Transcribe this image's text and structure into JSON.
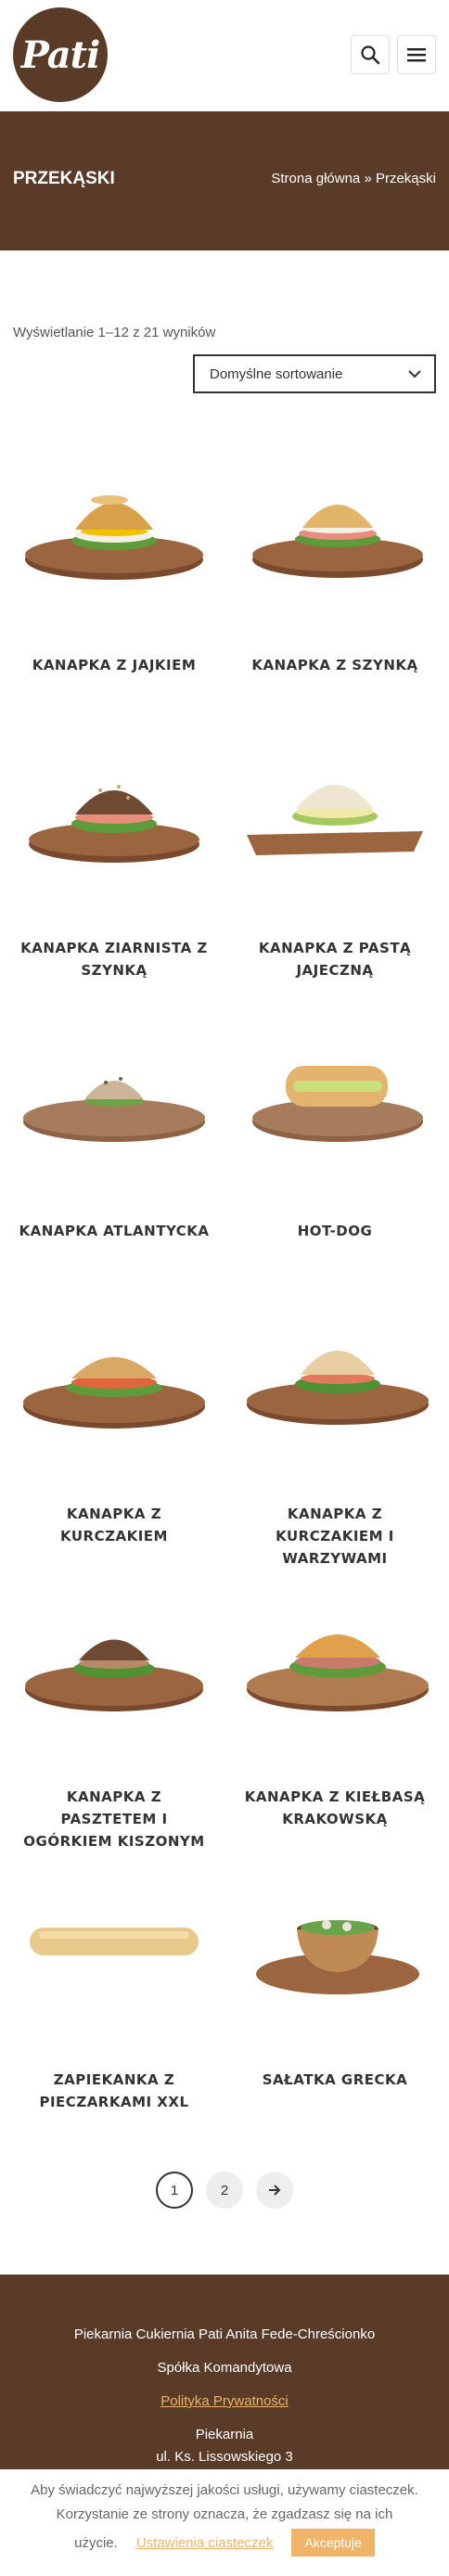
{
  "header": {
    "logo_text": "Pati",
    "search_icon": "search-icon",
    "menu_icon": "hamburger-menu-icon"
  },
  "banner": {
    "title": "PRZEKĄSKI",
    "breadcrumb_home": "Strona główna",
    "breadcrumb_sep": "»",
    "breadcrumb_current": "Przekąski"
  },
  "shop": {
    "results_text": "Wyświetlanie 1–12 z 21 wyników",
    "sort_selected": "Domyślne sortowanie"
  },
  "products": [
    {
      "name": "KANAPKA Z JAJKIEM"
    },
    {
      "name": "KANAPKA Z SZYNKĄ"
    },
    {
      "name": "KANAPKA ZIARNISTA Z SZYNKĄ"
    },
    {
      "name": "KANAPKA Z PASTĄ JAJECZNĄ"
    },
    {
      "name": "KANAPKA ATLANTYCKA"
    },
    {
      "name": "HOT-DOG"
    },
    {
      "name": "KANAPKA Z KURCZAKIEM"
    },
    {
      "name": "KANAPKA Z KURCZAKIEM I WARZYWAMI"
    },
    {
      "name": "KANAPKA Z PASZTETEM I OGÓRKIEM KISZONYM"
    },
    {
      "name": "KANAPKA Z KIEŁBASĄ KRAKOWSKĄ"
    },
    {
      "name": "ZAPIEKANKA Z PIECZARKAMI XXL"
    },
    {
      "name": "SAŁATKA GRECKA"
    }
  ],
  "pagination": {
    "page1": "1",
    "page2": "2",
    "next_icon": "arrow-right-icon"
  },
  "footer": {
    "company_line1": "Piekarnia Cukiernia Pati Anita Fede-Chreścionko",
    "company_line2": "Spółka Komandytowa",
    "privacy_link": "Polityka Prywatności",
    "section_label": "Piekarnia",
    "address": "ul. Ks. Lissowskiego 3"
  },
  "cookie": {
    "line1": "Aby świadczyć najwyższej jakości usługi, używamy ciasteczek.",
    "line2": "Korzystanie ze strony oznacza, że zgadzasz się na ich",
    "line3": "użycie.",
    "settings_link": "Ustawienia ciasteczek",
    "accept_button": "Akceptuje"
  },
  "colors": {
    "brand_brown": "#5a3b27",
    "accent_orange": "#f0b469"
  }
}
